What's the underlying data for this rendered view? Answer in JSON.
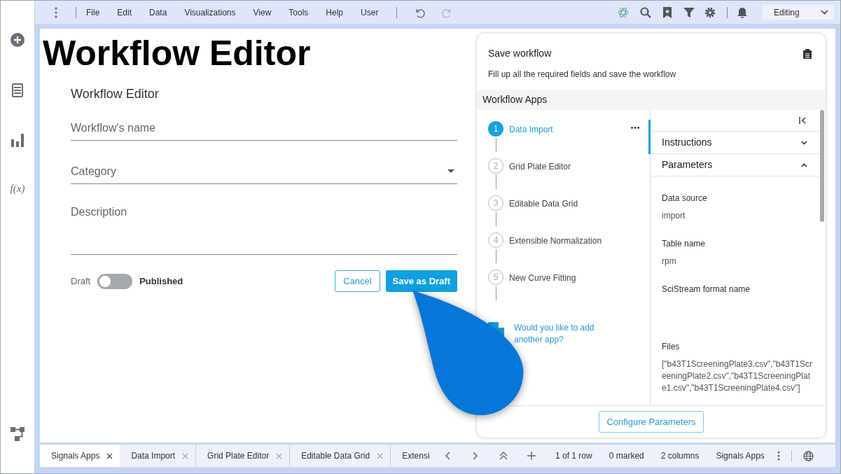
{
  "sidebar_function_label": "f(x)",
  "menu": [
    "File",
    "Edit",
    "Data",
    "Visualizations",
    "View",
    "Tools",
    "Help",
    "User"
  ],
  "mode": "Editing",
  "page_title": "Workflow Editor",
  "form": {
    "title": "Workflow Editor",
    "name_placeholder": "Workflow's name",
    "category_placeholder": "Category",
    "description_placeholder": "Description",
    "toggle_off_label": "Draft",
    "toggle_on_label": "Published",
    "published": false,
    "cancel": "Cancel",
    "save": "Save as Draft"
  },
  "panel": {
    "title": "Save workflow",
    "subtitle": "Fill up all the required fields and save the workflow",
    "section": "Workflow Apps",
    "steps": [
      {
        "number": "1",
        "label": "Data Import",
        "selected": true
      },
      {
        "number": "2",
        "label": "Grid Plate Editor",
        "selected": false
      },
      {
        "number": "3",
        "label": "Editable Data Grid",
        "selected": false
      },
      {
        "number": "4",
        "label": "Extensible Normalization",
        "selected": false
      },
      {
        "number": "5",
        "label": "New Curve Fitting",
        "selected": false
      }
    ],
    "add_app": "Would you like to add another app?",
    "accordions": [
      {
        "label": "Instructions",
        "expanded": false
      },
      {
        "label": "Parameters",
        "expanded": true
      }
    ],
    "params": [
      {
        "label": "Data source",
        "value": "import"
      },
      {
        "label": "Table name",
        "value": "rpm"
      },
      {
        "label": "SciStream format name"
      },
      {
        "label": "Files",
        "value": "[\"b43T1ScreeningPlate3.csv\",\"b43T1ScreeningPlate2.csv\",\"b43T1ScreeningPlate1.csv\",\"b43T1ScreeningPlate4.csv\"]"
      }
    ],
    "configure": "Configure Parameters"
  },
  "tabs": [
    {
      "label": "Signals Apps",
      "selected": true
    },
    {
      "label": "Data Import",
      "selected": false
    },
    {
      "label": "Grid Plate Editor",
      "selected": false
    },
    {
      "label": "Editable Data Grid",
      "selected": false
    },
    {
      "label": "Extensi",
      "selected": false
    }
  ],
  "status_bar": [
    "1 of 1 row",
    "0 marked",
    "2 columns",
    "Signals Apps"
  ]
}
